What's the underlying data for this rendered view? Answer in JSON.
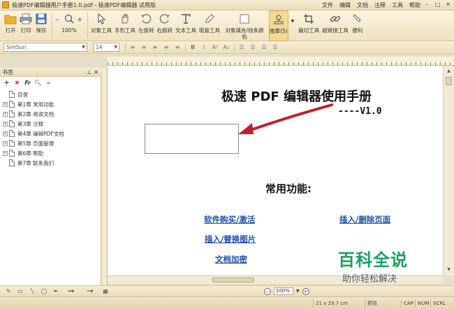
{
  "window": {
    "title": "极速PDF编辑器用户手册1.0.pdf - 极速PDF编辑器 试用版",
    "menus": [
      "文件",
      "编辑",
      "文档",
      "注释",
      "工具",
      "帮助"
    ]
  },
  "toolbar": {
    "open": "打开",
    "print": "打印",
    "save": "保存",
    "zoom": "100%",
    "object_tool": "对象工具",
    "hand_tool": "手形工具",
    "rotate_left": "左旋转",
    "rotate_right": "右旋转",
    "text_tool": "文本工具",
    "eyedropper": "吸管工具",
    "object_fill": "对象填充/线条颜色",
    "stamp": "图章(S)",
    "crop": "裁切工具",
    "hyperlink": "超链接工具",
    "last": "便利"
  },
  "format": {
    "font": "SimSun",
    "size": "14"
  },
  "bookmarks": {
    "header": "书签",
    "items": [
      {
        "label": "目录",
        "expandable": false
      },
      {
        "label": "第1章 常用功能",
        "expandable": true
      },
      {
        "label": "第2章 阅读文档",
        "expandable": true
      },
      {
        "label": "第3章 注释",
        "expandable": true
      },
      {
        "label": "第4章 编辑PDF文档",
        "expandable": true
      },
      {
        "label": "第5章 页面管理",
        "expandable": true
      },
      {
        "label": "第6章 帮助",
        "expandable": true
      },
      {
        "label": "第7章 联系我们",
        "expandable": false
      }
    ]
  },
  "document": {
    "title": "极速 PDF 编辑器使用手册",
    "version": "----V1.0",
    "heading": "常用功能:",
    "links": [
      "软件购买/激活",
      "插入/删除页面",
      "插入/替换图片",
      "文档加密"
    ]
  },
  "bottom": {
    "zoom": "100%"
  },
  "status": {
    "page_size": "21 x 29.7 cm",
    "mode": "预览",
    "cap": "CAP",
    "num": "NUM",
    "scrl": "SCRL"
  },
  "watermark": {
    "title": "百科全说",
    "subtitle": "助你轻松解决"
  }
}
